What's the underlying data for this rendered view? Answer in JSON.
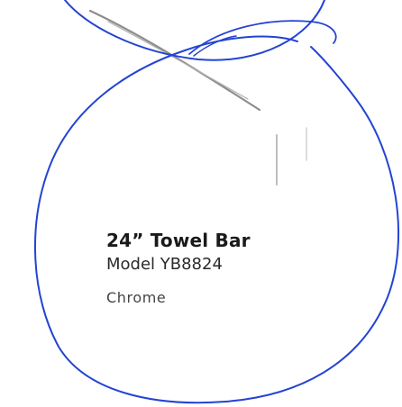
{
  "product": {
    "title": "24” Towel Bar",
    "model": "Model YB8824",
    "finish": "Chrome"
  },
  "colors": {
    "ink": "#1f3fd1",
    "pencil": "#8a8a8a",
    "text": "#1a1a1a"
  }
}
